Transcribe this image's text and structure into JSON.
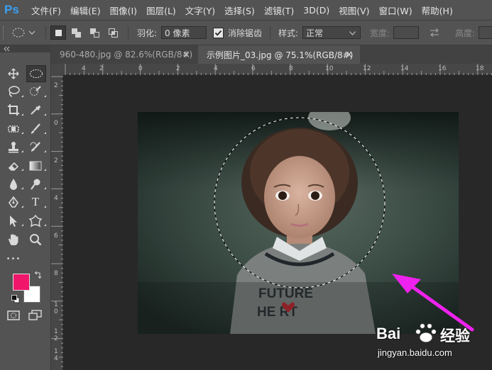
{
  "app": {
    "logo": "Ps"
  },
  "menu": [
    "文件(F)",
    "编辑(E)",
    "图像(I)",
    "图层(L)",
    "文字(Y)",
    "选择(S)",
    "滤镜(T)",
    "3D(D)",
    "视图(V)",
    "窗口(W)",
    "帮助(H)"
  ],
  "options": {
    "feather_label": "羽化:",
    "feather_value": "0 像素",
    "antialias_label": "消除锯齿",
    "antialias_checked": true,
    "style_label": "样式:",
    "style_value": "正常",
    "width_label": "宽度:",
    "height_label": "高度:"
  },
  "tabs": [
    {
      "label": "960-480.jpg @ 82.6%(RGB/8#)",
      "close": "×",
      "active": false
    },
    {
      "label": "示例图片_03.jpg @ 75.1%(RGB/8#)",
      "close": "×",
      "active": true
    }
  ],
  "ruler": {
    "top_labels": [
      "4",
      "2",
      "0",
      "2",
      "4",
      "6",
      "8",
      "10",
      "12",
      "14",
      "16",
      "18"
    ],
    "left_labels": [
      "2",
      "0",
      "2",
      "4",
      "6",
      "8",
      "1",
      "0",
      "1",
      "2",
      "1",
      "4",
      "1",
      "6"
    ]
  },
  "tools": {
    "ellipsis": "•••",
    "type_glyph": "T"
  },
  "colors": {
    "foreground": "#f0176a",
    "background": "#ffffff",
    "ui_panel": "#535353",
    "arrow": "#ee22ee"
  },
  "photo_text": {
    "shirt_line1": "FUTURE",
    "shirt_line2": "HE RT"
  },
  "watermark": {
    "brand_left": "Bai",
    "brand_right": "经验",
    "url": "jingyan.baidu.com"
  }
}
